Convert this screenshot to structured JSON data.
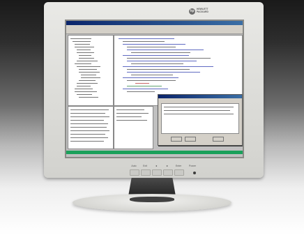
{
  "brand": {
    "logo_mark": "hp",
    "line1": "HEWLETT",
    "line2": "PACKARD"
  },
  "monitor": {
    "buttons": [
      {
        "label": "Auto"
      },
      {
        "label": "Exit"
      },
      {
        "label": "◄"
      },
      {
        "label": "►"
      },
      {
        "label": "Enter"
      },
      {
        "label": "Power"
      }
    ]
  },
  "colors": {
    "bezel": "#dcdcd8",
    "screen_status_bar": "#1aa05a",
    "window_title": "#0a246a"
  }
}
